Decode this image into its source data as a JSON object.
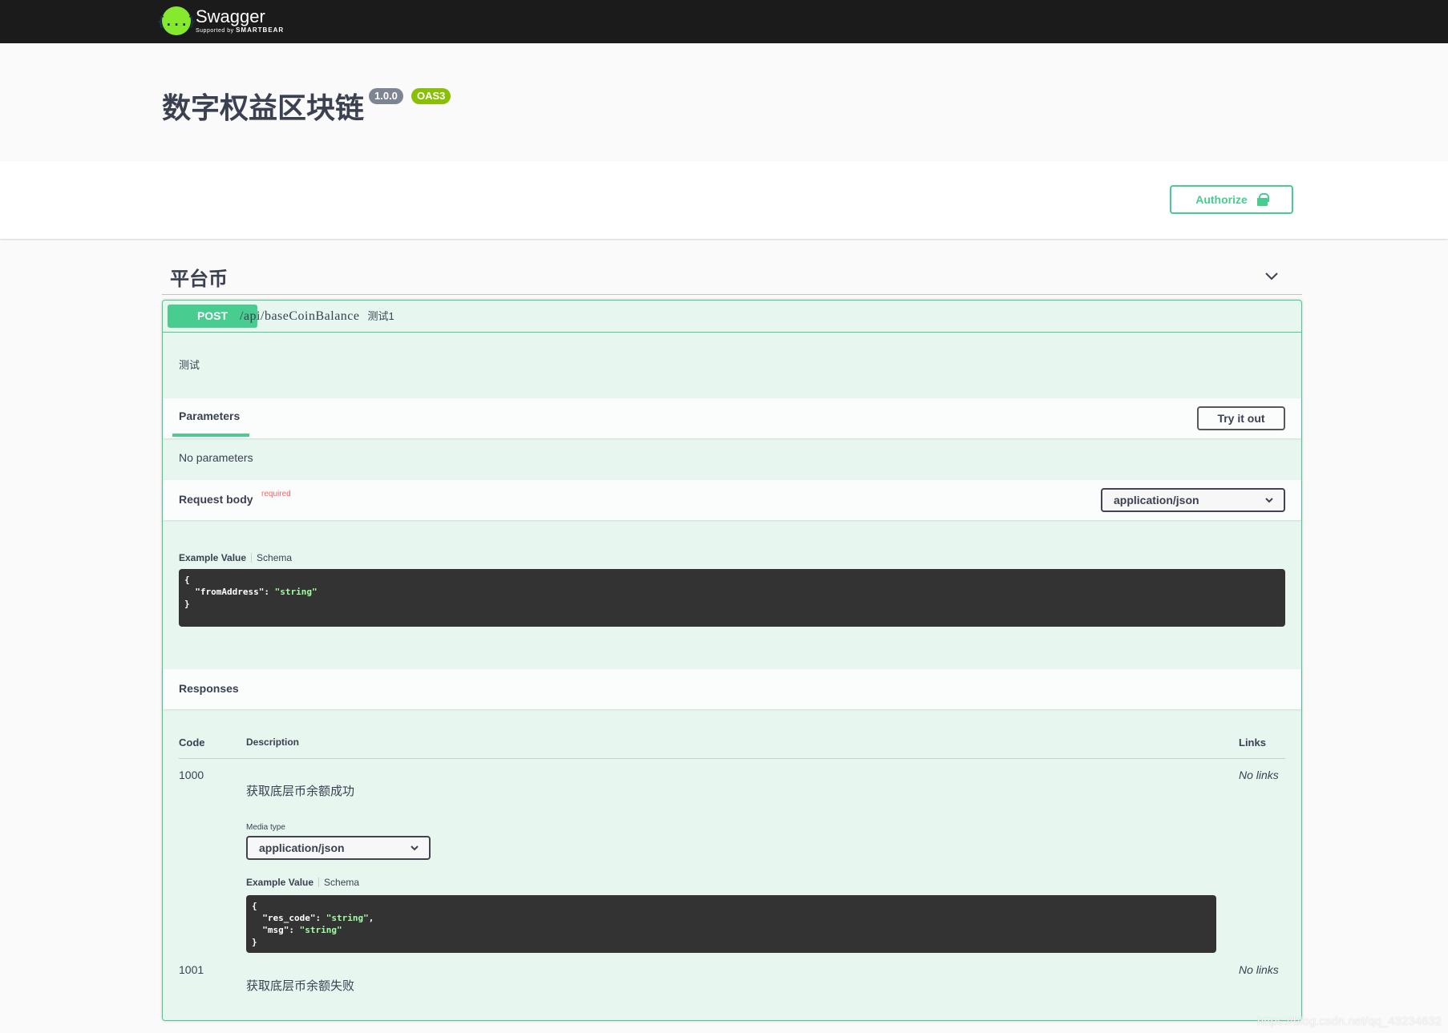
{
  "topbar": {
    "logo_mark": "{...}",
    "logo_name": "Swagger",
    "logo_sub_prefix": "Supported by ",
    "logo_sub_brand": "SMARTBEAR"
  },
  "info": {
    "title": "数字权益区块链",
    "version": "1.0.0",
    "oas": "OAS3"
  },
  "scheme": {
    "authorize_label": "Authorize"
  },
  "tag": {
    "name": "平台币"
  },
  "operation": {
    "method": "POST",
    "path": "/api/baseCoinBalance",
    "summary": "测试1",
    "description": "测试",
    "parameters_tab": "Parameters",
    "try_it_out": "Try it out",
    "no_parameters": "No parameters",
    "request_body_title": "Request body",
    "required_label": "required",
    "request_content_type": "application/json",
    "request_example_tab": "Example Value",
    "request_schema_tab": "Schema",
    "request_example": {
      "open": "{",
      "key": "  \"fromAddress\": ",
      "value": "\"string\"",
      "close": "}"
    },
    "responses_title": "Responses",
    "responses_columns": {
      "code": "Code",
      "description": "Description",
      "links": "Links"
    },
    "responses": [
      {
        "code": "1000",
        "description": "获取底层币余额成功",
        "links": "No links",
        "media_type_label": "Media type",
        "media_type": "application/json",
        "example_tab": "Example Value",
        "schema_tab": "Schema",
        "example": {
          "open": "{",
          "line1_key": "  \"res_code\": ",
          "line1_value": "\"string\"",
          "line1_comma": ",",
          "line2_key": "  \"msg\": ",
          "line2_value": "\"string\"",
          "close": "}"
        }
      },
      {
        "code": "1001",
        "description": "获取底层币余额失败",
        "links": "No links"
      }
    ]
  },
  "watermark": "https://blog.csdn.net/qq_43234632",
  "colors": {
    "post_green": "#49cc90",
    "topbar_bg": "#1b1b1b",
    "logo_green": "#85ea2d",
    "version_badge": "#7d8492",
    "oas_badge": "#89bf04",
    "code_bg": "#333333",
    "code_string": "#a2fca2",
    "required_red": "#ff6060"
  },
  "icons": {
    "logo": "swagger-logo-icon",
    "lock": "lock-icon",
    "tag_chevron": "chevron-down-icon",
    "select_chevron": "chevron-down-icon"
  }
}
